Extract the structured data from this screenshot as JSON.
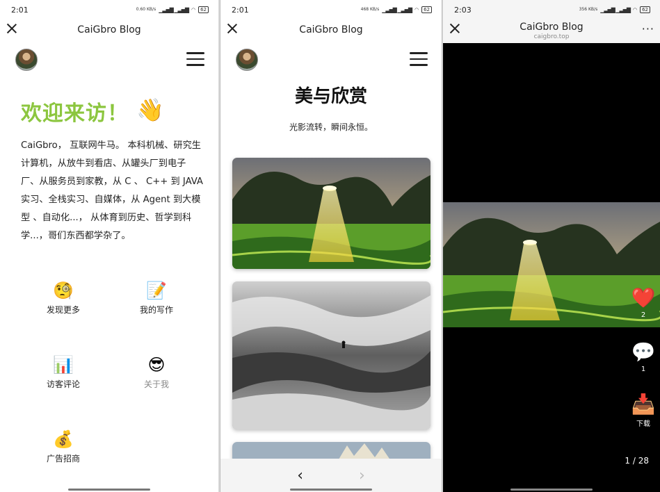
{
  "panels": [
    {
      "status": {
        "time": "2:01",
        "net": "0.60 KB/s",
        "battery": "62"
      },
      "title": "CaiGbro Blog",
      "welcome": "欢迎来访！",
      "welcome_emoji": "👋",
      "intro": "CaiGbro， 互联网牛马。 本科机械、研究生计算机，从放牛到看店、从罐头厂到电子厂、从服务员到家教，从 C 、 C++ 到 JAVA 实习、全栈实习、自媒体，从 Agent 到大模型 、自动化...， 从体育到历史、哲学到科学...，哥们东西都学杂了。",
      "grid": [
        {
          "icon": "🧐",
          "label": "发现更多"
        },
        {
          "icon": "📝",
          "label": "我的写作"
        },
        {
          "icon": "📊",
          "label": "访客评论"
        },
        {
          "icon": "😎",
          "label": "关于我"
        },
        {
          "icon": "💰",
          "label": "广告招商"
        }
      ]
    },
    {
      "status": {
        "time": "2:01",
        "net": "468 KB/s",
        "battery": "62"
      },
      "title": "CaiGbro Blog",
      "heading": "美与欣赏",
      "subheading": "光影流转，瞬间永恒。",
      "nav": {
        "prev": "‹",
        "next": "›"
      }
    },
    {
      "status": {
        "time": "2:03",
        "net": "356 KB/s",
        "battery": "62"
      },
      "title": "CaiGbro Blog",
      "subtitle": "caigbro.top",
      "more": "···",
      "actions": [
        {
          "icon": "❤️",
          "label": "2"
        },
        {
          "icon": "💬",
          "label": "1"
        },
        {
          "icon": "📥",
          "label": "下载"
        }
      ],
      "counter": "1 / 28"
    }
  ],
  "colors": {
    "accent_green": "#8cc63f",
    "viewer_bg": "#000000"
  }
}
